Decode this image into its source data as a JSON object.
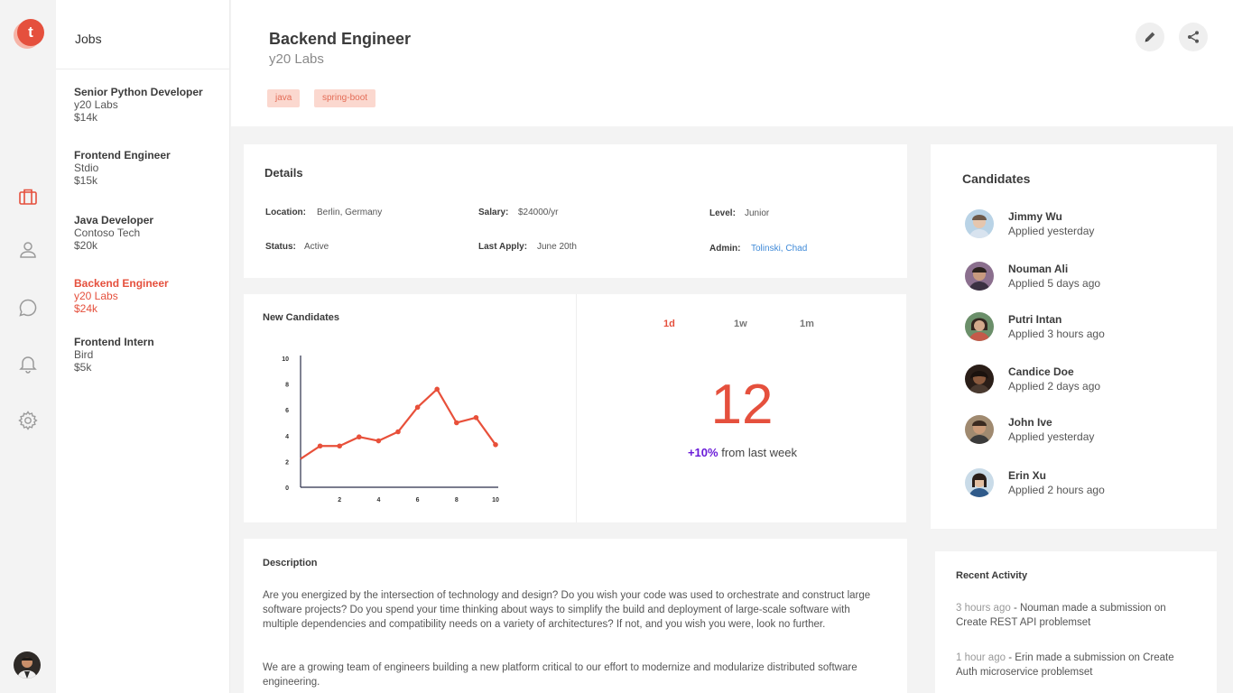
{
  "app": {
    "logo_letter": "t"
  },
  "rail": {
    "icons": [
      "briefcase-icon",
      "user-icon",
      "chat-icon",
      "bell-icon",
      "gear-icon"
    ],
    "active_color": "#e5503d"
  },
  "jobs": {
    "title": "Jobs",
    "items": [
      {
        "title": "Senior Python Developer",
        "company": "y20 Labs",
        "salary": "$14k"
      },
      {
        "title": "Frontend Engineer",
        "company": "Stdio",
        "salary": "$15k"
      },
      {
        "title": "Java Developer",
        "company": "Contoso Tech",
        "salary": "$20k"
      },
      {
        "title": "Backend Engineer",
        "company": "y20 Labs",
        "salary": "$24k"
      },
      {
        "title": "Frontend Intern",
        "company": "Bird",
        "salary": "$5k"
      }
    ]
  },
  "header": {
    "title": "Backend Engineer",
    "company": "y20 Labs",
    "tags": [
      "java",
      "spring-boot"
    ]
  },
  "details": {
    "title": "Details",
    "location_label": "Location:",
    "location": "Berlin, Germany",
    "salary_label": "Salary:",
    "salary": "$24000/yr",
    "level_label": "Level:",
    "level": "Junior",
    "status_label": "Status:",
    "status": "Active",
    "last_apply_label": "Last Apply:",
    "last_apply": "June 20th",
    "admin_label": "Admin:",
    "admin": "Tolinski, Chad"
  },
  "new_candidates": {
    "title": "New Candidates",
    "tabs": [
      "1d",
      "1w",
      "1m"
    ],
    "active_tab": "1d",
    "count": "12",
    "delta": "+10%",
    "delta_suffix": "from last week"
  },
  "chart_data": {
    "type": "line",
    "title": "",
    "xlabel": "",
    "ylabel": "",
    "x": [
      0,
      1,
      2,
      3,
      4,
      5,
      6,
      7,
      8,
      9,
      10
    ],
    "series": [
      {
        "values": [
          2.2,
          3.2,
          3.2,
          3.9,
          3.6,
          4.3,
          6.2,
          7.6,
          5.0,
          5.4,
          3.3
        ],
        "color": "#e8503a"
      }
    ],
    "xlim": [
      0,
      10
    ],
    "ylim": [
      0,
      10
    ],
    "xticks": [
      "2",
      "4",
      "6",
      "8",
      "10"
    ],
    "yticks": [
      "0",
      "2",
      "4",
      "6",
      "8",
      "10"
    ],
    "grid": false
  },
  "description": {
    "title": "Description",
    "p1": "Are you energized by the intersection of technology and design? Do you wish your code was used to orchestrate and construct large software projects? Do you spend your time thinking about ways to simplify the build and deployment of large-scale software with multiple dependencies and compatibility needs on a variety of architectures? If not, and you wish you were, look no further.",
    "p2": "We are a growing team of engineers building a new platform critical to our effort to modernize and modularize distributed software engineering."
  },
  "candidates": {
    "title": "Candidates",
    "items": [
      {
        "name": "Jimmy Wu",
        "applied": "Applied yesterday"
      },
      {
        "name": "Nouman Ali",
        "applied": "Applied 5 days ago"
      },
      {
        "name": "Putri Intan",
        "applied": "Applied 3 hours ago"
      },
      {
        "name": "Candice Doe",
        "applied": "Applied 2 days ago"
      },
      {
        "name": "John Ive",
        "applied": "Applied yesterday"
      },
      {
        "name": "Erin Xu",
        "applied": "Applied 2 hours ago"
      }
    ]
  },
  "activity": {
    "title": "Recent Activity",
    "items": [
      {
        "time": "3 hours ago",
        "text": " - Nouman made a submission on Create REST API problemset"
      },
      {
        "time": "1 hour ago",
        "text": " - Erin made a submission on Create Auth microservice problemset"
      }
    ]
  }
}
